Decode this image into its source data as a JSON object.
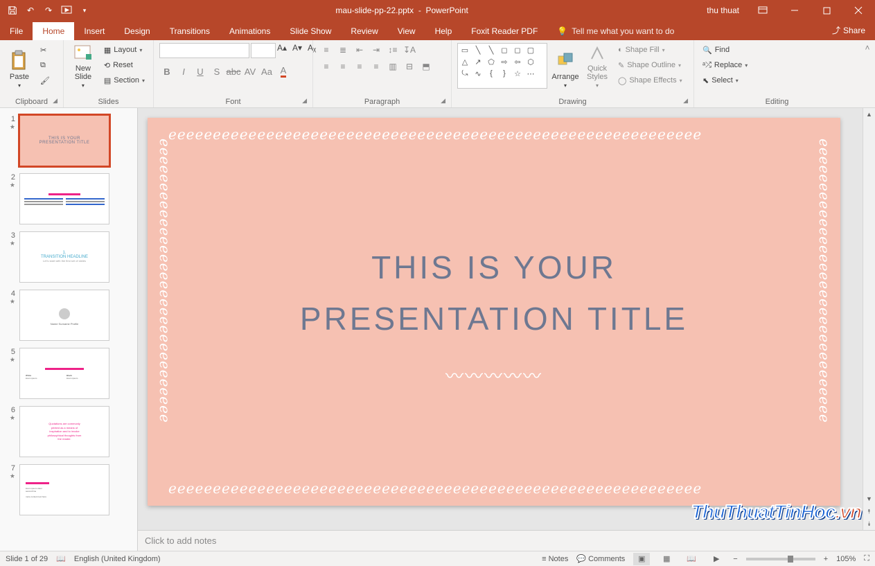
{
  "titlebar": {
    "filename": "mau-slide-pp-22.pptx",
    "appname": "PowerPoint",
    "username": "thu thuat"
  },
  "tabs": {
    "file": "File",
    "home": "Home",
    "insert": "Insert",
    "design": "Design",
    "transitions": "Transitions",
    "animations": "Animations",
    "slideshow": "Slide Show",
    "review": "Review",
    "view": "View",
    "help": "Help",
    "foxit": "Foxit Reader PDF",
    "tellme": "Tell me what you want to do",
    "share": "Share"
  },
  "ribbon": {
    "clipboard": {
      "label": "Clipboard",
      "paste": "Paste"
    },
    "slides": {
      "label": "Slides",
      "newslide": "New\nSlide",
      "layout": "Layout",
      "reset": "Reset",
      "section": "Section"
    },
    "font": {
      "label": "Font",
      "fontname": "",
      "fontsize": ""
    },
    "paragraph": {
      "label": "Paragraph"
    },
    "drawing": {
      "label": "Drawing",
      "arrange": "Arrange",
      "quickstyles": "Quick\nStyles",
      "shapefill": "Shape Fill",
      "shapeoutline": "Shape Outline",
      "shapeeffects": "Shape Effects"
    },
    "editing": {
      "label": "Editing",
      "find": "Find",
      "replace": "Replace",
      "select": "Select"
    }
  },
  "thumbnails": [
    {
      "n": "1",
      "selected": true,
      "bg": "#f6c1b2",
      "text": "THIS IS YOUR\nPRESENTATION TITLE"
    },
    {
      "n": "2",
      "selected": false,
      "bg": "#fff",
      "text": ""
    },
    {
      "n": "3",
      "selected": false,
      "bg": "#fff",
      "text": "TRANSITION HEADLINE"
    },
    {
      "n": "4",
      "selected": false,
      "bg": "#fff",
      "text": ""
    },
    {
      "n": "5",
      "selected": false,
      "bg": "#fff",
      "text": ""
    },
    {
      "n": "6",
      "selected": false,
      "bg": "#fff",
      "text": "Quotations are commonly\nprinted as a means of\ninspiration and to invoke\nphilosophical thoughts from\nthe reader."
    },
    {
      "n": "7",
      "selected": false,
      "bg": "#fff",
      "text": ""
    }
  ],
  "slide": {
    "title_line1": "This is your",
    "title_line2": "presentation title"
  },
  "notes_placeholder": "Click to add notes",
  "statusbar": {
    "slideinfo": "Slide 1 of 29",
    "language": "English (United Kingdom)",
    "notes": "Notes",
    "comments": "Comments",
    "zoom": "105%"
  },
  "watermark": {
    "main": "ThuThuatTinHoc",
    "ext": ".vn"
  }
}
